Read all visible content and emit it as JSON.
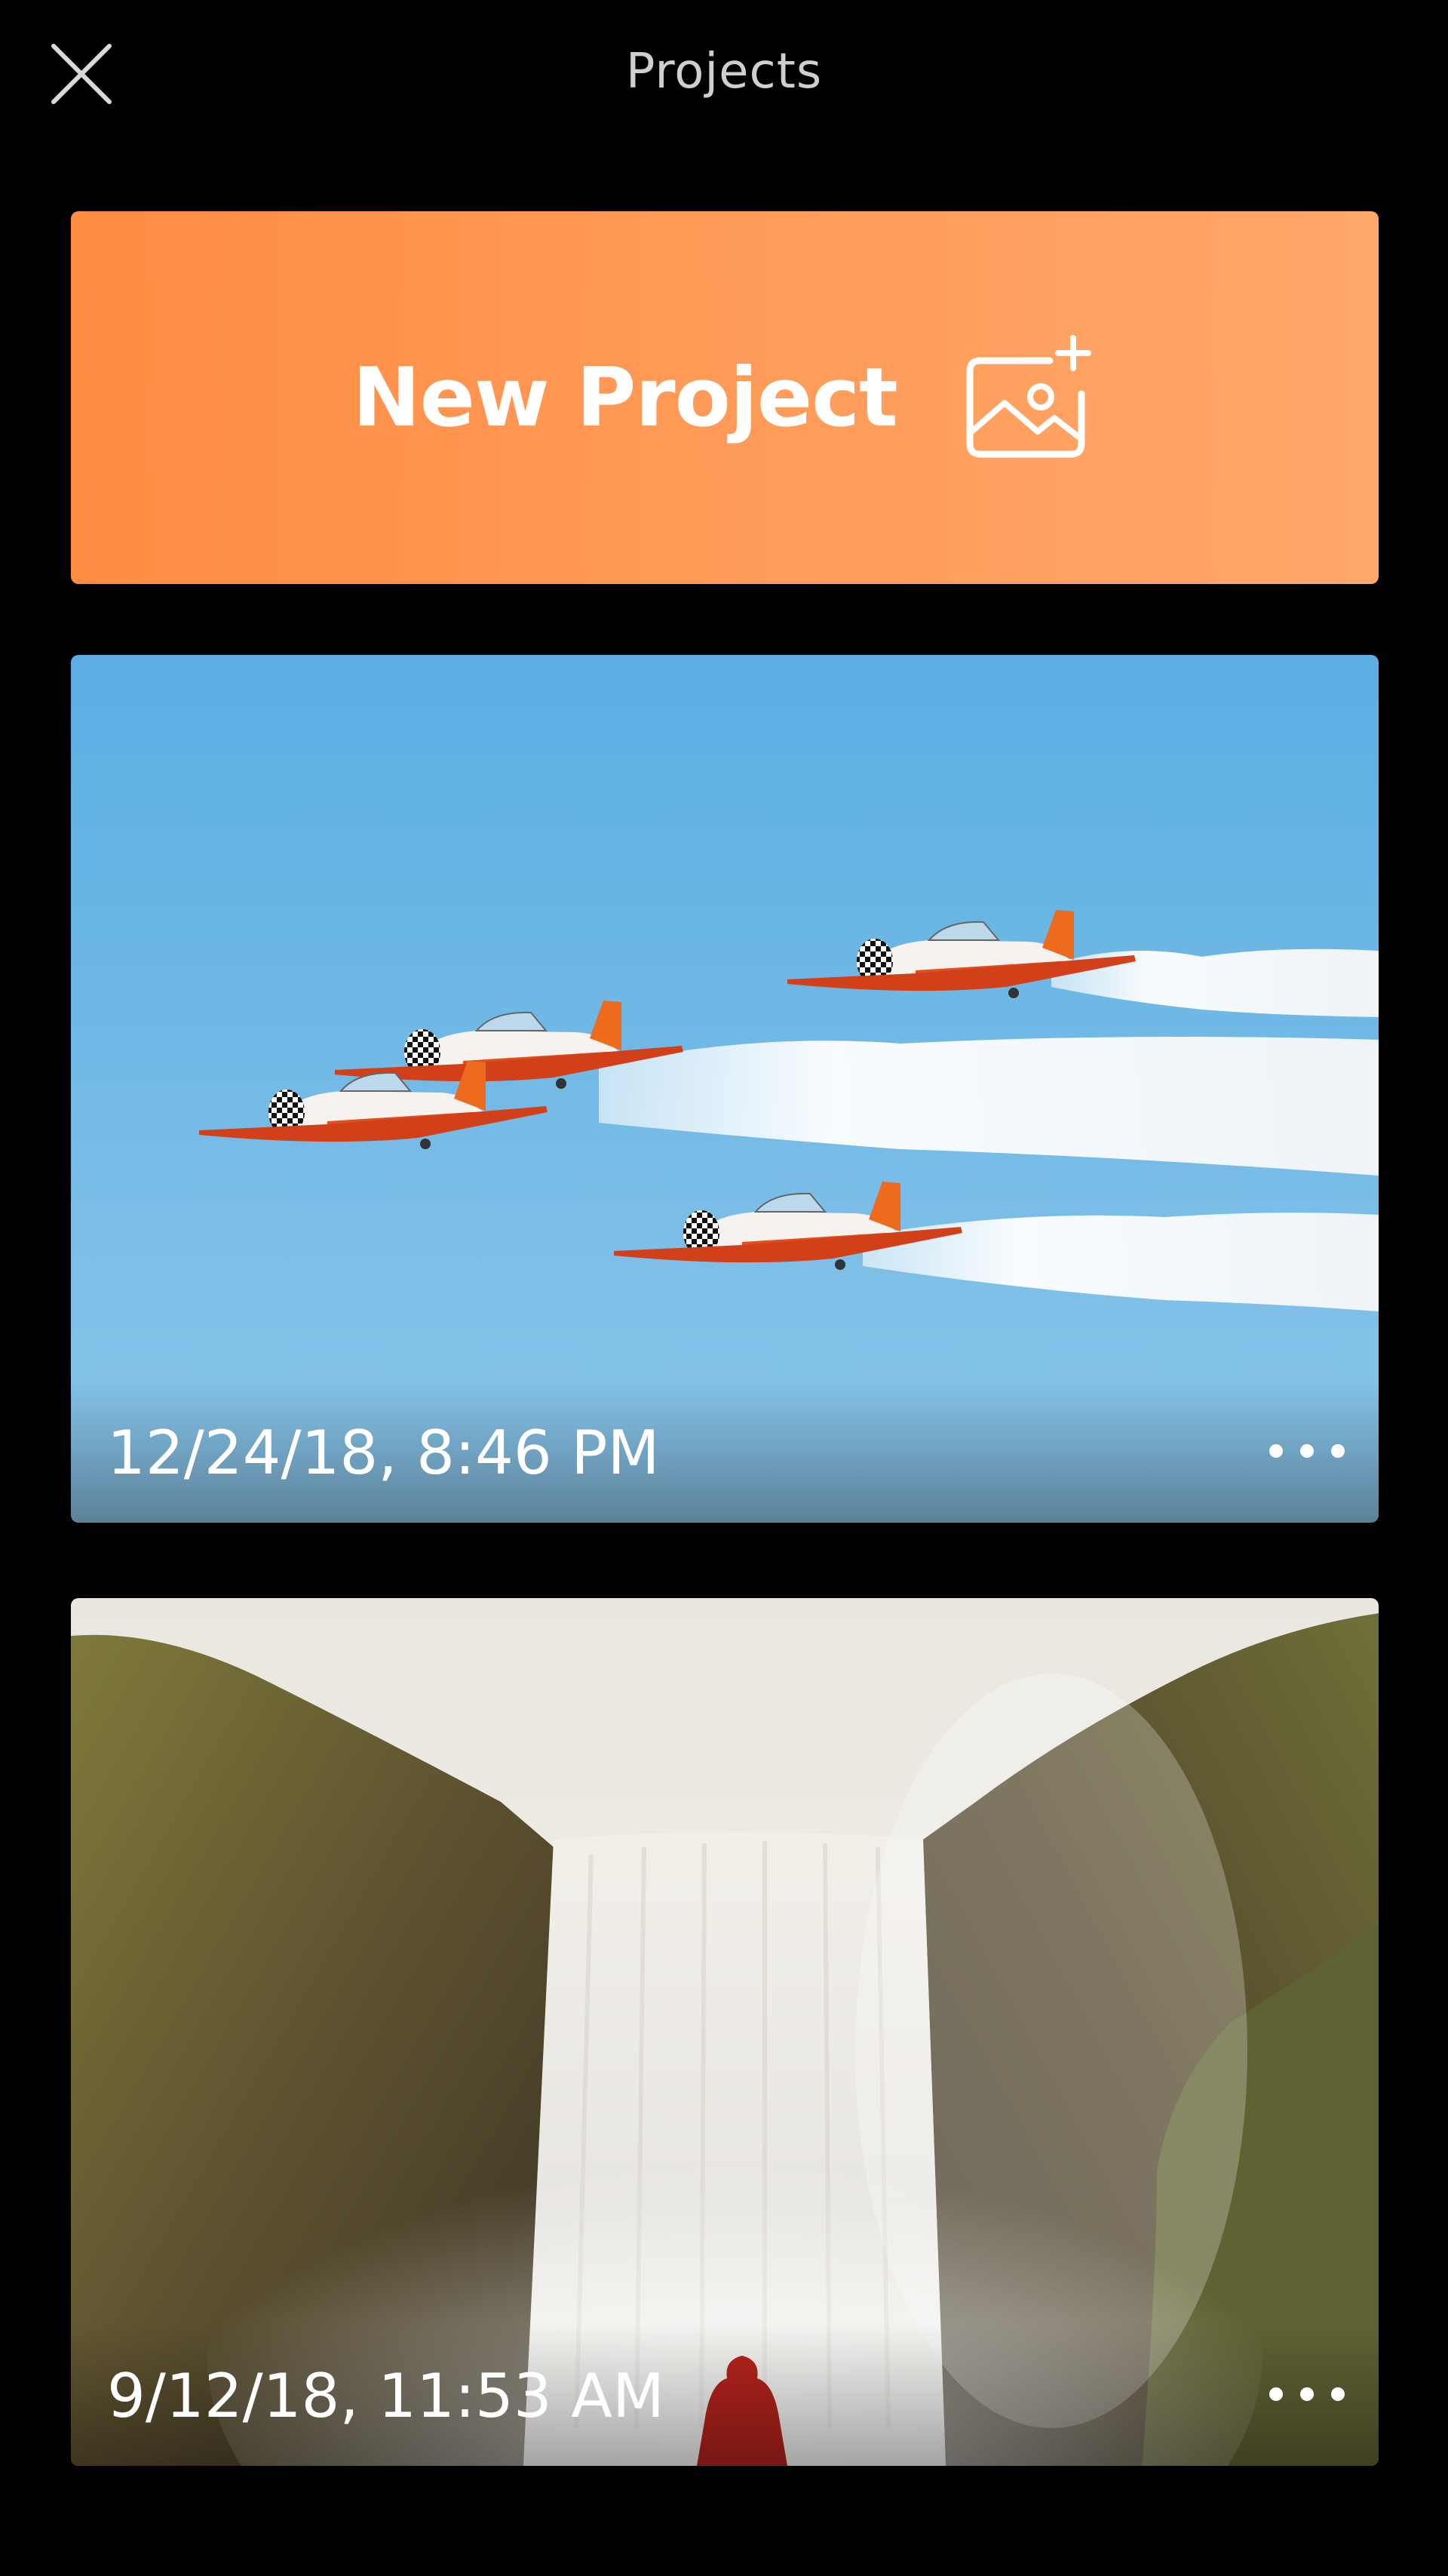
{
  "header": {
    "title": "Projects",
    "close_icon": "close-icon"
  },
  "new_project": {
    "label": "New Project",
    "icon": "add-photo-icon",
    "color_start": "#ff8c43",
    "color_end": "#ffa86a"
  },
  "projects": [
    {
      "date": "12/24/18, 8:46 PM",
      "thumbnail": "airplanes-formation-smoke",
      "more_icon": "more-dots-icon"
    },
    {
      "date": "9/12/18, 11:53 AM",
      "thumbnail": "waterfall-cliffs",
      "more_icon": "more-dots-icon"
    }
  ]
}
